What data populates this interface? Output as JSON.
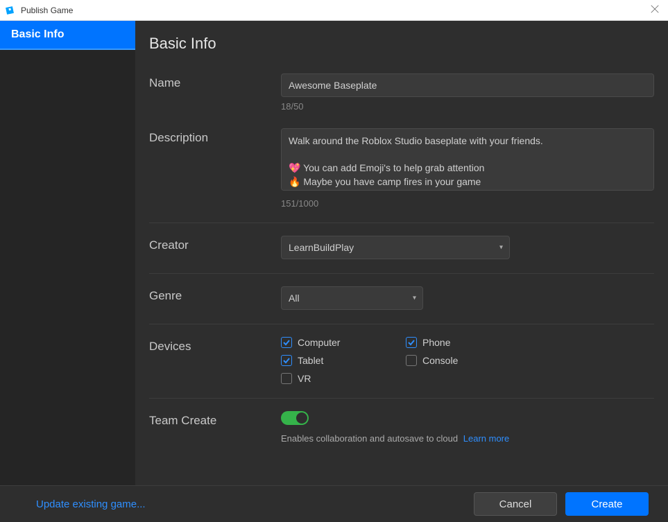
{
  "window": {
    "title": "Publish Game"
  },
  "sidebar": {
    "items": [
      {
        "label": "Basic Info"
      }
    ]
  },
  "header": {
    "title": "Basic Info"
  },
  "name": {
    "label": "Name",
    "value": "Awesome Baseplate",
    "counter": "18/50"
  },
  "description": {
    "label": "Description",
    "value": "Walk around the Roblox Studio baseplate with your friends.\n\n💖 You can add Emoji's to help grab attention\n🔥 Maybe you have camp fires in your game",
    "counter": "151/1000"
  },
  "creator": {
    "label": "Creator",
    "selected": "LearnBuildPlay"
  },
  "genre": {
    "label": "Genre",
    "selected": "All"
  },
  "devices": {
    "label": "Devices",
    "options": {
      "computer": "Computer",
      "phone": "Phone",
      "tablet": "Tablet",
      "console": "Console",
      "vr": "VR"
    }
  },
  "teamcreate": {
    "label": "Team Create",
    "desc": "Enables collaboration and autosave to cloud",
    "learn": "Learn more"
  },
  "footer": {
    "update_link": "Update existing game...",
    "cancel": "Cancel",
    "create": "Create"
  }
}
